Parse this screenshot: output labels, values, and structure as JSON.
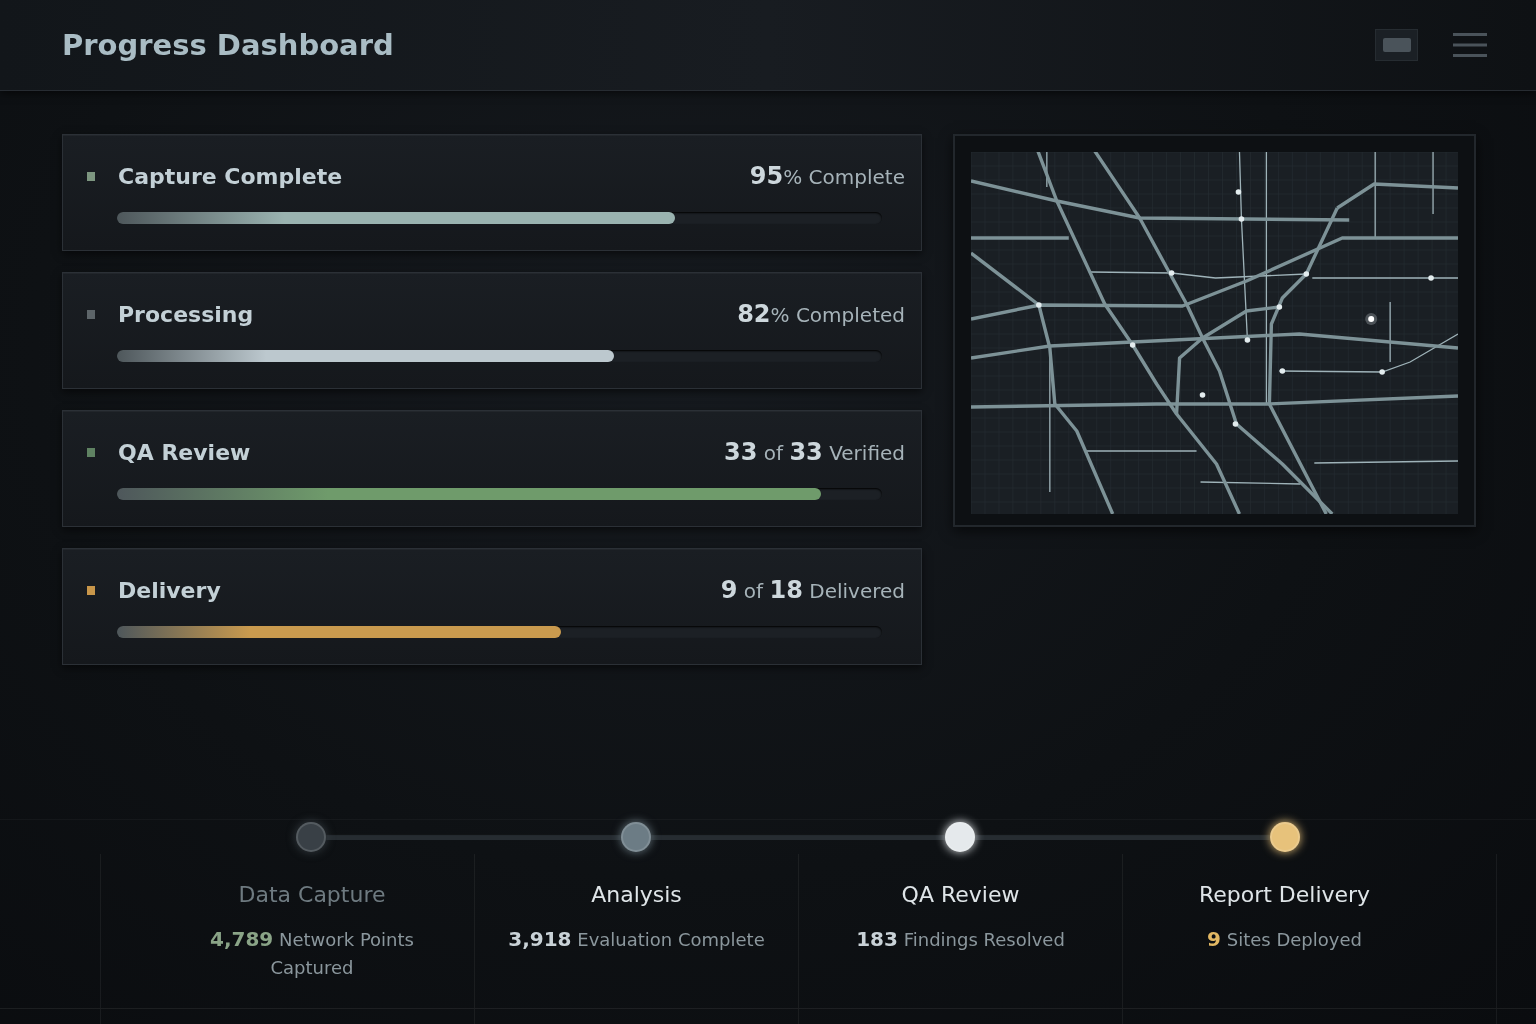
{
  "header": {
    "title": "Progress Dashboard"
  },
  "stages": [
    {
      "title": "Capture Complete",
      "status": "**95**% Complete",
      "color": "#7d9680",
      "bar": {
        "level": 0.73,
        "color": "#9ab3b0"
      }
    },
    {
      "title": "Processing",
      "status": "**82**% Completed",
      "color": "#5d6569",
      "bar": {
        "level": 0.65,
        "color": "#bcc8ce"
      }
    },
    {
      "title": "QA Review",
      "status": "**33** of **33** Verified",
      "color": "#5f8262",
      "bar": {
        "level": 0.92,
        "color": "#6f9b6b"
      }
    },
    {
      "title": "Delivery",
      "status": "**9** of **18** Delivered",
      "color": "#c8964a",
      "bar": {
        "level": 0.58,
        "color": "#c99a4e"
      }
    }
  ],
  "timeline": [
    {
      "title": "Data Capture",
      "muted": true,
      "node": {
        "color": "#394046"
      },
      "stat": {
        "value": "4,789",
        "label": "Network Points Captured",
        "color": "#8aa487"
      }
    },
    {
      "title": "Analysis",
      "muted": false,
      "node": {
        "color": "#6c7c85"
      },
      "stat": {
        "value": "3,918",
        "label": "Evaluation Complete",
        "color": "#c9d2d7"
      }
    },
    {
      "title": "QA Review",
      "muted": false,
      "node": {
        "color": "#e5e9ec"
      },
      "stat": {
        "value": "183",
        "label": "Findings Resolved",
        "color": "#c9d2d7"
      }
    },
    {
      "title": "Report Delivery",
      "muted": false,
      "node": {
        "color": "#e7c27b"
      },
      "stat": {
        "value": "9",
        "label": "Sites Deployed",
        "color": "#e2b863"
      }
    }
  ]
}
